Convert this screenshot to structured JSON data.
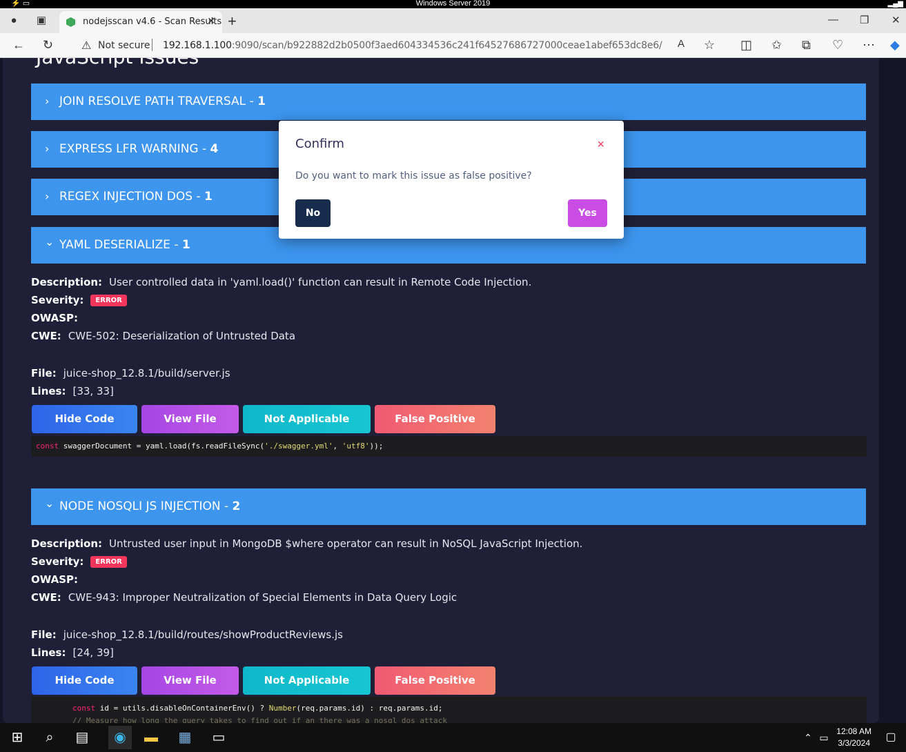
{
  "remote_bar": {
    "title": "Windows Server 2019"
  },
  "browser": {
    "tab_title": "nodejsscan v4.6 - Scan Results",
    "not_secure": "Not secure",
    "url_host": "192.168.1.100",
    "url_rest": ":9090/scan/b922882d2b0500f3aed604334536c241f64527686727000ceae1abef653dc8e6/"
  },
  "page": {
    "section_title": "JavaScript Issues",
    "accordions": [
      {
        "label": "JOIN RESOLVE PATH TRAVERSAL -",
        "count": "1",
        "chev": "›"
      },
      {
        "label": "EXPRESS LFR WARNING -",
        "count": "4",
        "chev": "›"
      },
      {
        "label": "REGEX INJECTION DOS -",
        "count": "1",
        "chev": "›"
      },
      {
        "label": "YAML DESERIALIZE -",
        "count": "1",
        "chev": "⌄"
      },
      {
        "label": "NODE NOSQLI JS INJECTION -",
        "count": "2",
        "chev": "⌄"
      }
    ],
    "labels": {
      "description": "Description:",
      "severity": "Severity:",
      "owasp": "OWASP:",
      "cwe": "CWE:",
      "file": "File:",
      "lines": "Lines:"
    },
    "issue1": {
      "description": "User controlled data in 'yaml.load()' function can result in Remote Code Injection.",
      "severity": "ERROR",
      "cwe": "CWE-502: Deserialization of Untrusted Data",
      "file": "juice-shop_12.8.1/build/server.js",
      "lines": "[33, 33]"
    },
    "issue2": {
      "description": "Untrusted user input in MongoDB $where operator can result in NoSQL JavaScript Injection.",
      "severity": "ERROR",
      "cwe": "CWE-943: Improper Neutralization of Special Elements in Data Query Logic",
      "file": "juice-shop_12.8.1/build/routes/showProductReviews.js",
      "lines": "[24, 39]"
    },
    "buttons": {
      "hide_code": "Hide Code",
      "view_file": "View File",
      "not_applicable": "Not Applicable",
      "false_positive": "False Positive"
    }
  },
  "modal": {
    "title": "Confirm",
    "close": "×",
    "body": "Do you want to mark this issue as false positive?",
    "no": "No",
    "yes": "Yes"
  },
  "taskbar": {
    "time": "12:08 AM",
    "date": "3/3/2024"
  }
}
